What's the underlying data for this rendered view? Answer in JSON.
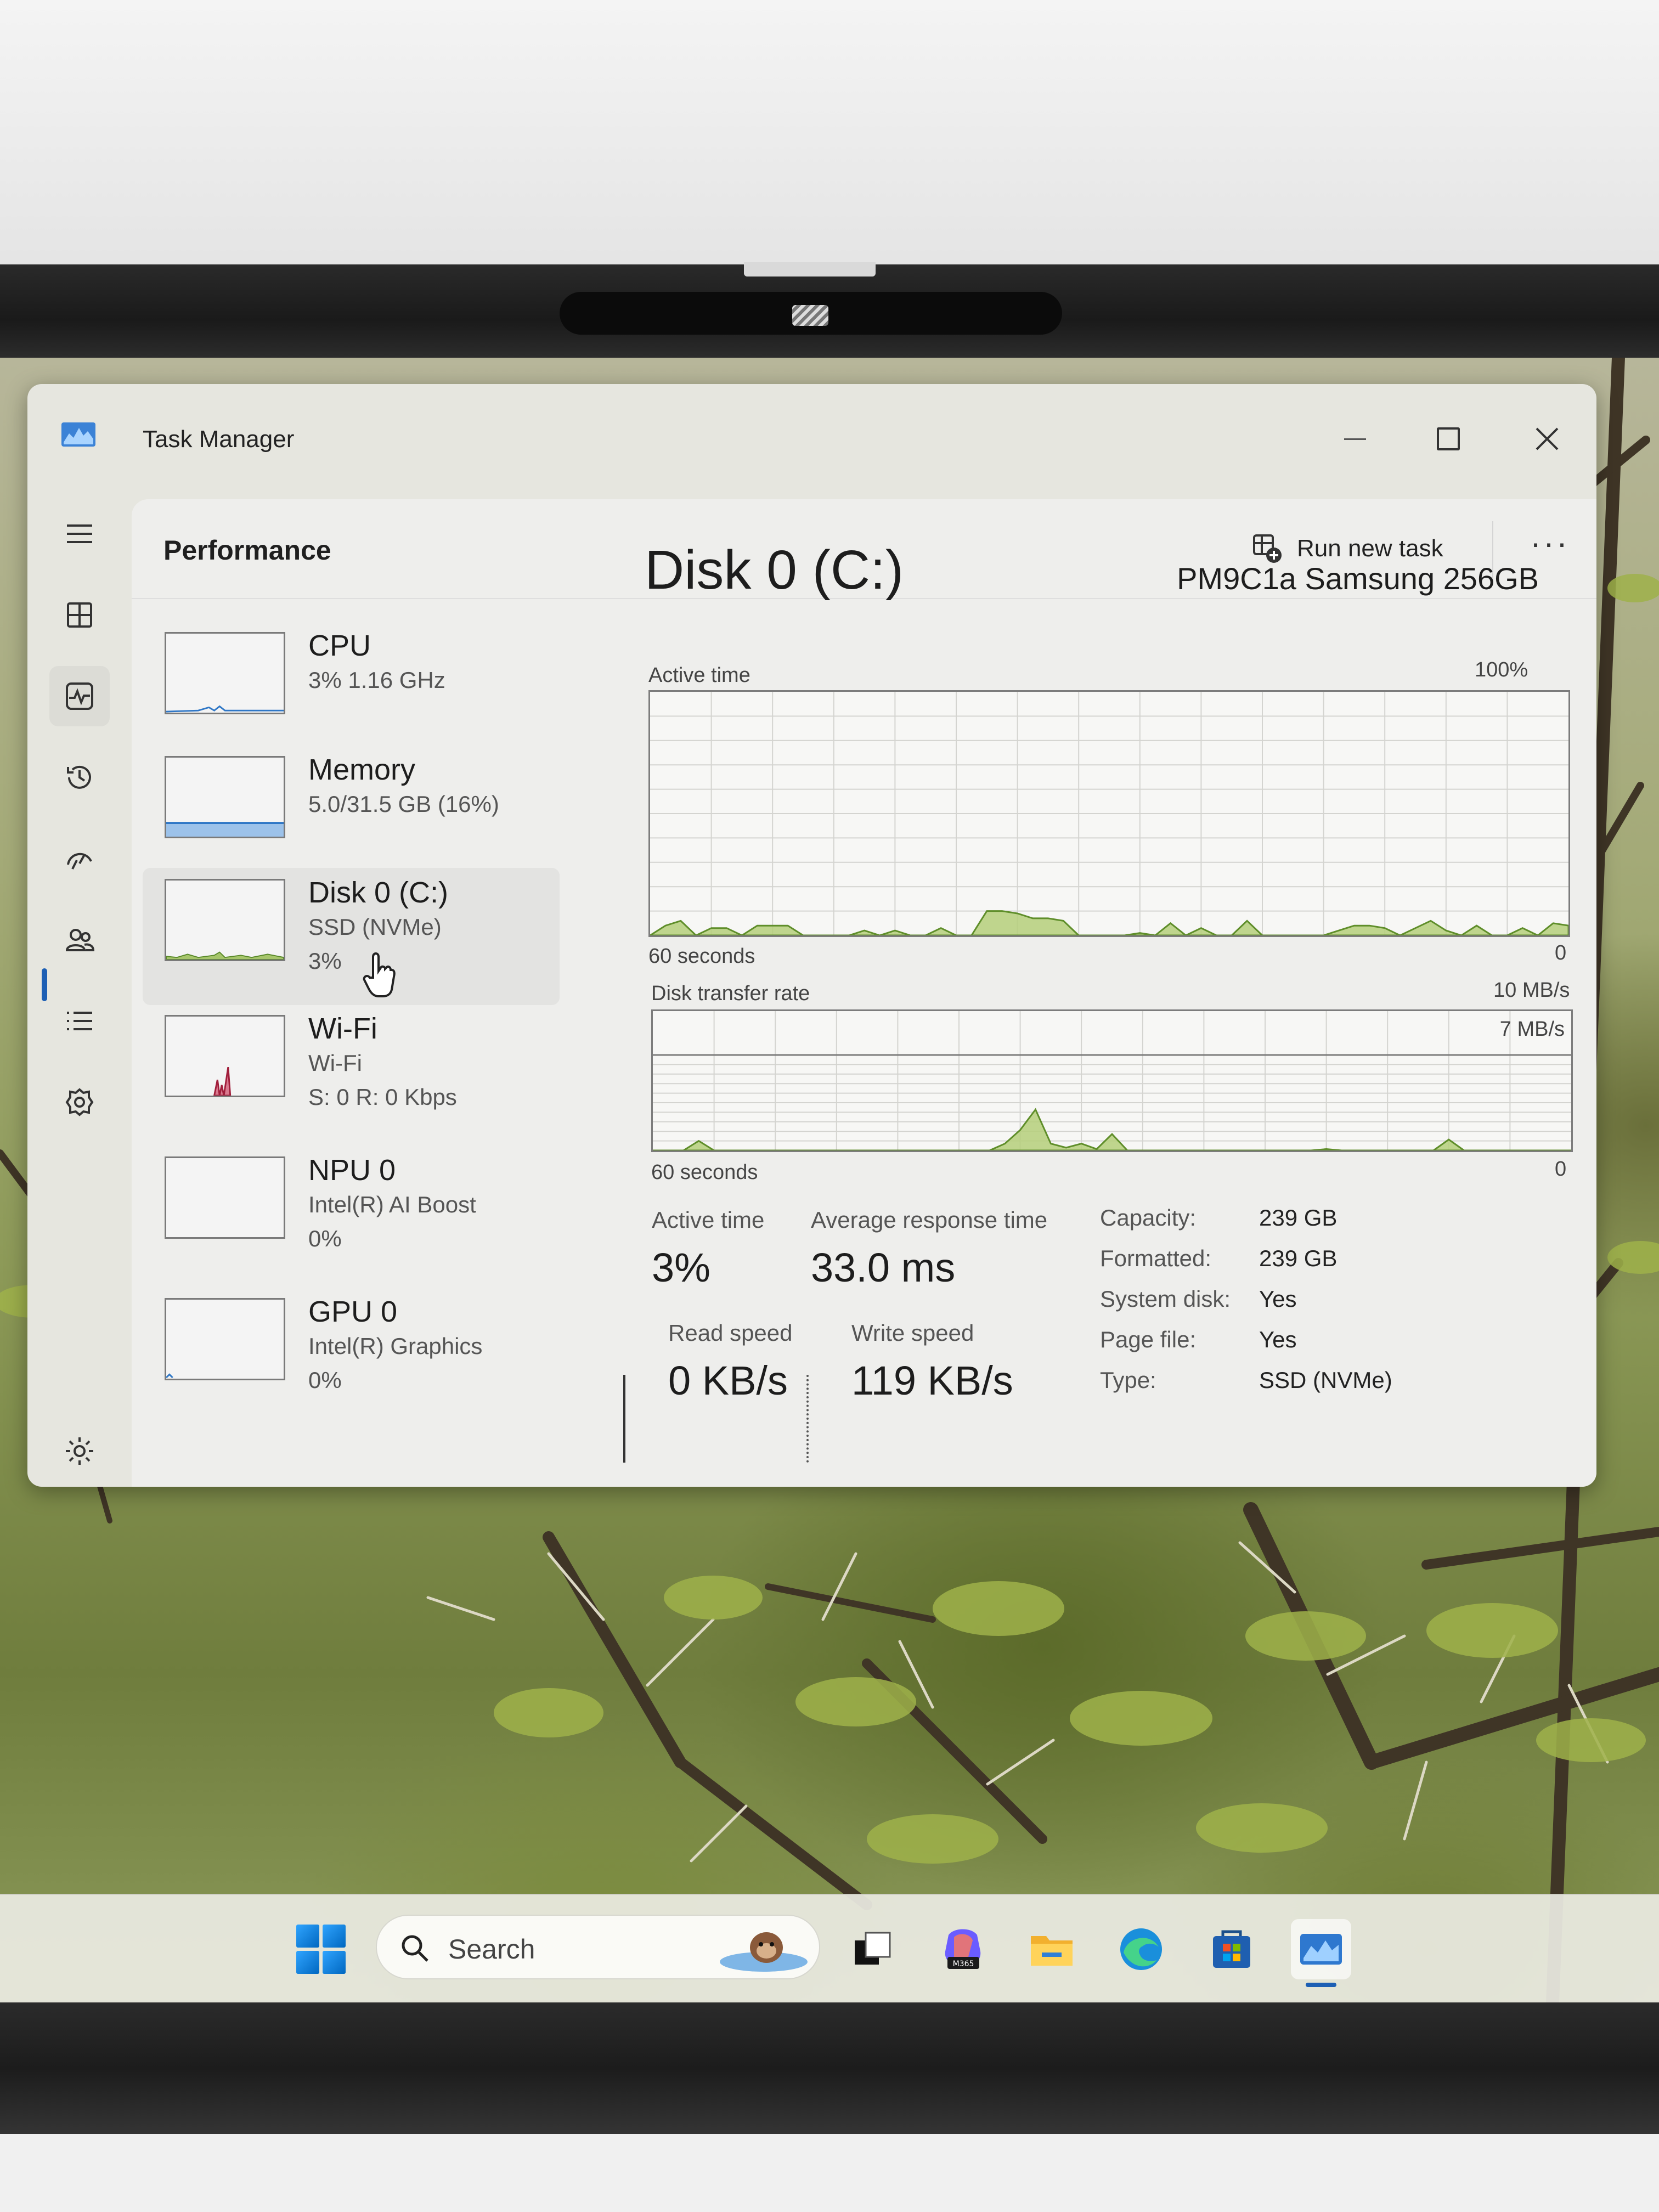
{
  "window": {
    "title": "Task Manager"
  },
  "header": {
    "page_title": "Performance",
    "run_new_task": "Run new task",
    "more_icon": "more-icon"
  },
  "nav_icons": [
    "hamburger-icon",
    "processes-icon",
    "performance-icon",
    "app-history-icon",
    "startup-apps-icon",
    "users-icon",
    "details-icon",
    "services-icon",
    "settings-icon"
  ],
  "devices": [
    {
      "name": "CPU",
      "line1": "3%  1.16 GHz",
      "line2": ""
    },
    {
      "name": "Memory",
      "line1": "5.0/31.5 GB (16%)",
      "line2": ""
    },
    {
      "name": "Disk 0 (C:)",
      "line1": "SSD (NVMe)",
      "line2": "3%"
    },
    {
      "name": "Wi-Fi",
      "line1": "Wi-Fi",
      "line2": "S: 0  R: 0 Kbps"
    },
    {
      "name": "NPU 0",
      "line1": "Intel(R) AI Boost",
      "line2": "0%"
    },
    {
      "name": "GPU 0",
      "line1": "Intel(R) Graphics",
      "line2": "0%"
    }
  ],
  "detail": {
    "title": "Disk 0 (C:)",
    "model": "PM9C1a Samsung 256GB",
    "active_chart": {
      "label": "Active time",
      "max": "100%",
      "time": "60 seconds",
      "min": "0"
    },
    "transfer_chart": {
      "label": "Disk transfer rate",
      "max": "10 MB/s",
      "inner_max": "7 MB/s",
      "time": "60 seconds",
      "min": "0"
    },
    "stats": {
      "active_time_label": "Active time",
      "active_time": "3%",
      "avg_response_label": "Average response time",
      "avg_response": "33.0 ms",
      "read_label": "Read speed",
      "read": "0 KB/s",
      "write_label": "Write speed",
      "write": "119 KB/s"
    },
    "properties": [
      {
        "key": "Capacity:",
        "value": "239 GB"
      },
      {
        "key": "Formatted:",
        "value": "239 GB"
      },
      {
        "key": "System disk:",
        "value": "Yes"
      },
      {
        "key": "Page file:",
        "value": "Yes"
      },
      {
        "key": "Type:",
        "value": "SSD (NVMe)"
      }
    ]
  },
  "chart_data": [
    {
      "type": "area",
      "title": "Active time",
      "ylim": [
        0,
        100
      ],
      "xlabel": "60 seconds",
      "x": [
        0,
        1,
        2,
        3,
        4,
        5,
        6,
        7,
        8,
        9,
        10,
        11,
        12,
        13,
        14,
        15,
        16,
        17,
        18,
        19,
        20,
        21,
        22,
        23,
        24,
        25,
        26,
        27,
        28,
        29,
        30,
        31,
        32,
        33,
        34,
        35,
        36,
        37,
        38,
        39,
        40,
        41,
        42,
        43,
        44,
        45,
        46,
        47,
        48,
        49,
        50,
        51,
        52,
        53,
        54,
        55,
        56,
        57,
        58,
        59,
        60
      ],
      "series": [
        {
          "values": [
            0,
            4,
            6,
            0,
            3,
            3,
            0,
            4,
            4,
            4,
            0,
            0,
            0,
            0,
            2,
            0,
            2,
            0,
            0,
            3,
            0,
            0,
            10,
            10,
            9,
            7,
            7,
            6,
            0,
            0,
            0,
            0,
            1,
            0,
            5,
            0,
            3,
            0,
            0,
            6,
            0,
            0,
            0,
            0,
            0,
            2,
            4,
            4,
            3,
            0,
            3,
            6,
            2,
            0,
            4,
            0,
            0,
            3,
            0,
            5,
            4
          ]
        }
      ]
    },
    {
      "type": "area",
      "title": "Disk transfer rate",
      "ylim": [
        0,
        10
      ],
      "xlabel": "60 seconds",
      "x": [
        0,
        1,
        2,
        3,
        4,
        5,
        6,
        7,
        8,
        9,
        10,
        11,
        12,
        13,
        14,
        15,
        16,
        17,
        18,
        19,
        20,
        21,
        22,
        23,
        24,
        25,
        26,
        27,
        28,
        29,
        30,
        31,
        32,
        33,
        34,
        35,
        36,
        37,
        38,
        39,
        40,
        41,
        42,
        43,
        44,
        45,
        46,
        47,
        48,
        49,
        50,
        51,
        52,
        53,
        54,
        55,
        56,
        57,
        58,
        59,
        60
      ],
      "series": [
        {
          "values": [
            0,
            0,
            0,
            0.7,
            0,
            0,
            0,
            0,
            0,
            0,
            0,
            0,
            0,
            0,
            0,
            0,
            0,
            0,
            0,
            0,
            0,
            0,
            0,
            0.5,
            1.5,
            3.0,
            0.5,
            0.2,
            0.5,
            0.1,
            1.2,
            0,
            0,
            0,
            0,
            0,
            0,
            0,
            0,
            0,
            0,
            0,
            0,
            0,
            0.1,
            0,
            0,
            0,
            0,
            0,
            0,
            0,
            0.8,
            0,
            0,
            0,
            0,
            0,
            0,
            0,
            0
          ]
        }
      ]
    }
  ],
  "taskbar": {
    "search_placeholder": "Search",
    "apps": [
      "task-view-icon",
      "m365-copilot-icon",
      "file-explorer-icon",
      "edge-icon",
      "microsoft-store-icon",
      "task-manager-icon"
    ],
    "m365_label": "M365"
  }
}
